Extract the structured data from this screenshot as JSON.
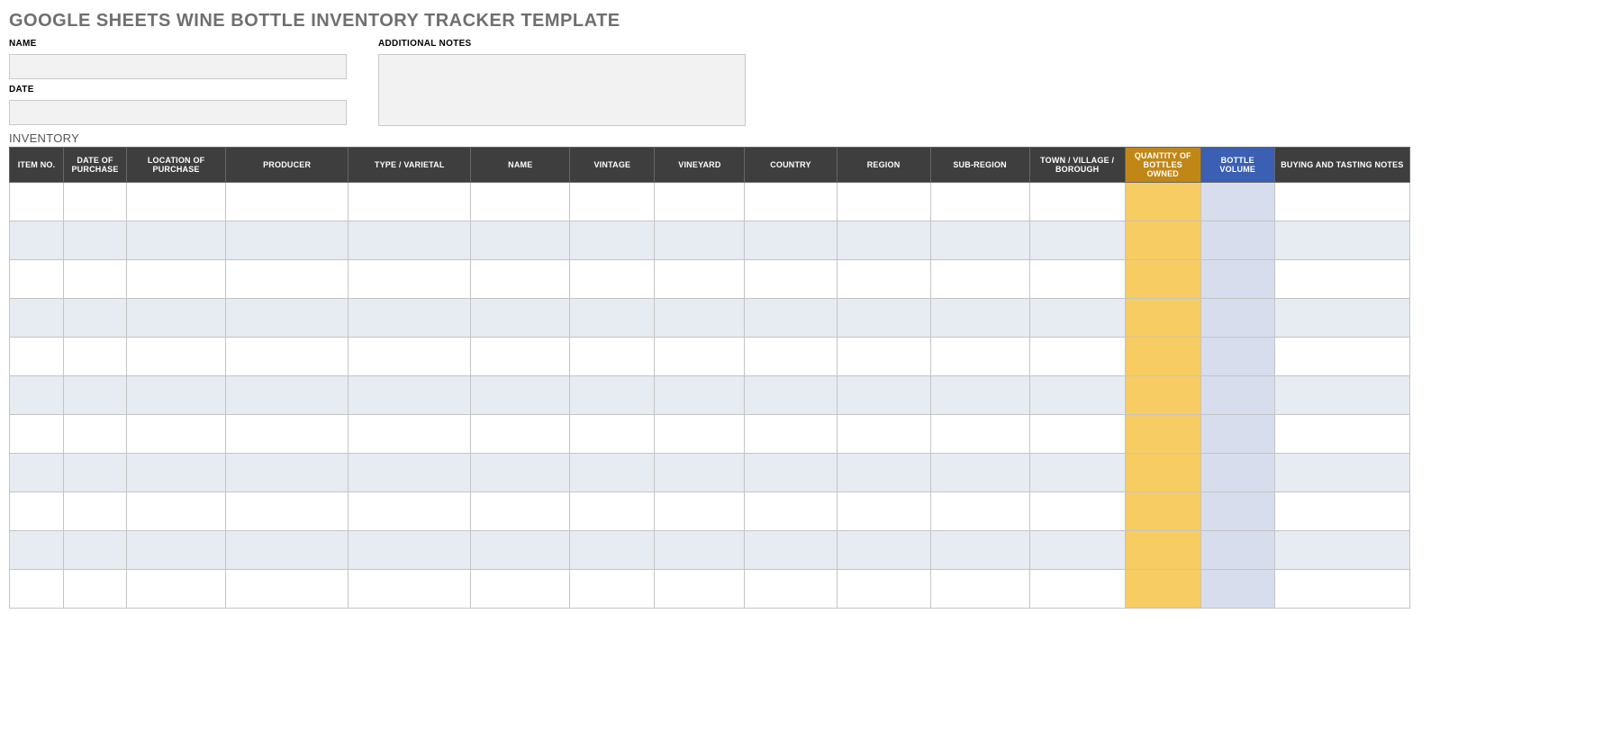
{
  "title": "GOOGLE SHEETS WINE BOTTLE INVENTORY TRACKER TEMPLATE",
  "form": {
    "name_label": "NAME",
    "name_value": "",
    "date_label": "DATE",
    "date_value": "",
    "notes_label": "ADDITIONAL NOTES",
    "notes_value": ""
  },
  "inventory_label": "INVENTORY",
  "columns": [
    "ITEM NO.",
    "DATE OF PURCHASE",
    "LOCATION OF PURCHASE",
    "PRODUCER",
    "TYPE / VARIETAL",
    "NAME",
    "VINTAGE",
    "VINEYARD",
    "COUNTRY",
    "REGION",
    "SUB-REGION",
    "TOWN / VILLAGE / BOROUGH",
    "QUANTITY OF BOTTLES OWNED",
    "BOTTLE VOLUME",
    "BUYING AND TASTING NOTES"
  ],
  "rows": [
    {
      "item": "",
      "dop": "",
      "loc": "",
      "prod": "",
      "type": "",
      "name": "",
      "vint": "",
      "viny": "",
      "ctry": "",
      "reg": "",
      "sreg": "",
      "town": "",
      "qty": "",
      "vol": "",
      "notes": ""
    },
    {
      "item": "",
      "dop": "",
      "loc": "",
      "prod": "",
      "type": "",
      "name": "",
      "vint": "",
      "viny": "",
      "ctry": "",
      "reg": "",
      "sreg": "",
      "town": "",
      "qty": "",
      "vol": "",
      "notes": ""
    },
    {
      "item": "",
      "dop": "",
      "loc": "",
      "prod": "",
      "type": "",
      "name": "",
      "vint": "",
      "viny": "",
      "ctry": "",
      "reg": "",
      "sreg": "",
      "town": "",
      "qty": "",
      "vol": "",
      "notes": ""
    },
    {
      "item": "",
      "dop": "",
      "loc": "",
      "prod": "",
      "type": "",
      "name": "",
      "vint": "",
      "viny": "",
      "ctry": "",
      "reg": "",
      "sreg": "",
      "town": "",
      "qty": "",
      "vol": "",
      "notes": ""
    },
    {
      "item": "",
      "dop": "",
      "loc": "",
      "prod": "",
      "type": "",
      "name": "",
      "vint": "",
      "viny": "",
      "ctry": "",
      "reg": "",
      "sreg": "",
      "town": "",
      "qty": "",
      "vol": "",
      "notes": ""
    },
    {
      "item": "",
      "dop": "",
      "loc": "",
      "prod": "",
      "type": "",
      "name": "",
      "vint": "",
      "viny": "",
      "ctry": "",
      "reg": "",
      "sreg": "",
      "town": "",
      "qty": "",
      "vol": "",
      "notes": ""
    },
    {
      "item": "",
      "dop": "",
      "loc": "",
      "prod": "",
      "type": "",
      "name": "",
      "vint": "",
      "viny": "",
      "ctry": "",
      "reg": "",
      "sreg": "",
      "town": "",
      "qty": "",
      "vol": "",
      "notes": ""
    },
    {
      "item": "",
      "dop": "",
      "loc": "",
      "prod": "",
      "type": "",
      "name": "",
      "vint": "",
      "viny": "",
      "ctry": "",
      "reg": "",
      "sreg": "",
      "town": "",
      "qty": "",
      "vol": "",
      "notes": ""
    },
    {
      "item": "",
      "dop": "",
      "loc": "",
      "prod": "",
      "type": "",
      "name": "",
      "vint": "",
      "viny": "",
      "ctry": "",
      "reg": "",
      "sreg": "",
      "town": "",
      "qty": "",
      "vol": "",
      "notes": ""
    },
    {
      "item": "",
      "dop": "",
      "loc": "",
      "prod": "",
      "type": "",
      "name": "",
      "vint": "",
      "viny": "",
      "ctry": "",
      "reg": "",
      "sreg": "",
      "town": "",
      "qty": "",
      "vol": "",
      "notes": ""
    },
    {
      "item": "",
      "dop": "",
      "loc": "",
      "prod": "",
      "type": "",
      "name": "",
      "vint": "",
      "viny": "",
      "ctry": "",
      "reg": "",
      "sreg": "",
      "town": "",
      "qty": "",
      "vol": "",
      "notes": ""
    }
  ]
}
